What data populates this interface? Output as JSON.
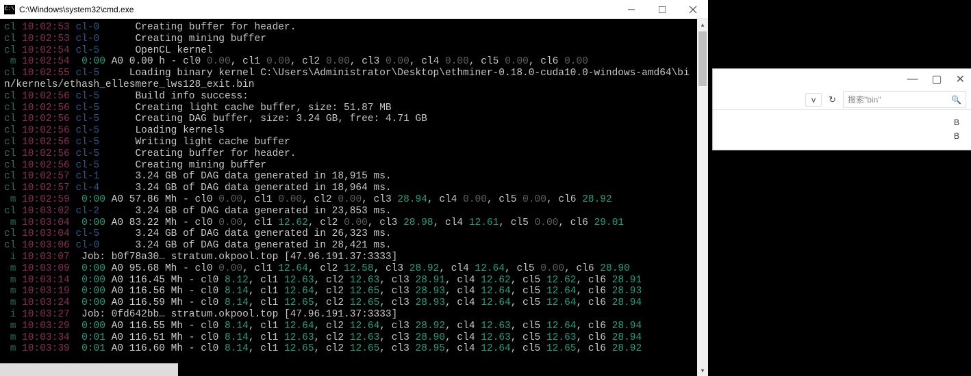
{
  "cmd": {
    "title": "C:\\Windows\\system32\\cmd.exe",
    "icon_label": "C:\\"
  },
  "bg": {
    "search_placeholder": "搜索\"bin\"",
    "row1": "B",
    "row2": "B"
  },
  "lines": [
    {
      "pid": "cl",
      "time": "10:02:53",
      "ctx": "cl-0",
      "type": "msg",
      "msg": "Creating buffer for header."
    },
    {
      "pid": "cl",
      "time": "10:02:53",
      "ctx": "cl-0",
      "type": "msg",
      "msg": "Creating mining buffer"
    },
    {
      "pid": "cl",
      "time": "10:02:54",
      "ctx": "cl-5",
      "type": "msg",
      "msg": "OpenCL kernel"
    },
    {
      "pid": " m",
      "time": "10:02:54",
      "ctx": "<unknown>",
      "type": "rate",
      "elapsed": "0:00",
      "a0": "0.00 h",
      "cls": [
        {
          "n": "cl0",
          "v": "0.00"
        },
        {
          "n": "cl1",
          "v": "0.00"
        },
        {
          "n": "cl2",
          "v": "0.00"
        },
        {
          "n": "cl3",
          "v": "0.00"
        },
        {
          "n": "cl4",
          "v": "0.00"
        },
        {
          "n": "cl5",
          "v": "0.00"
        },
        {
          "n": "cl6",
          "v": "0.00"
        }
      ]
    },
    {
      "pid": "cl",
      "time": "10:02:55",
      "ctx": "cl-5",
      "type": "longmsg",
      "msg": "Loading binary kernel C:\\Users\\Administrator\\Desktop\\ethminer-0.18.0-cuda10.0-windows-amd64\\bin/kernels/ethash_ellesmere_lws128_exit.bin"
    },
    {
      "pid": "cl",
      "time": "10:02:56",
      "ctx": "cl-5",
      "type": "msg",
      "msg": "Build info success:"
    },
    {
      "pid": "cl",
      "time": "10:02:56",
      "ctx": "cl-5",
      "type": "msg",
      "msg": "Creating light cache buffer, size: 51.87 MB"
    },
    {
      "pid": "cl",
      "time": "10:02:56",
      "ctx": "cl-5",
      "type": "msg",
      "msg": "Creating DAG buffer, size: 3.24 GB, free: 4.71 GB"
    },
    {
      "pid": "cl",
      "time": "10:02:56",
      "ctx": "cl-5",
      "type": "msg",
      "msg": "Loading kernels"
    },
    {
      "pid": "cl",
      "time": "10:02:56",
      "ctx": "cl-5",
      "type": "msg",
      "msg": "Writing light cache buffer"
    },
    {
      "pid": "cl",
      "time": "10:02:56",
      "ctx": "cl-5",
      "type": "msg",
      "msg": "Creating buffer for header."
    },
    {
      "pid": "cl",
      "time": "10:02:56",
      "ctx": "cl-5",
      "type": "msg",
      "msg": "Creating mining buffer"
    },
    {
      "pid": "cl",
      "time": "10:02:57",
      "ctx": "cl-1",
      "type": "msg",
      "msg": "3.24 GB of DAG data generated in 18,915 ms."
    },
    {
      "pid": "cl",
      "time": "10:02:57",
      "ctx": "cl-4",
      "type": "msg",
      "msg": "3.24 GB of DAG data generated in 18,964 ms."
    },
    {
      "pid": " m",
      "time": "10:02:59",
      "ctx": "<unknown>",
      "type": "rate",
      "elapsed": "0:00",
      "a0": "57.86 Mh",
      "cls": [
        {
          "n": "cl0",
          "v": "0.00"
        },
        {
          "n": "cl1",
          "v": "0.00"
        },
        {
          "n": "cl2",
          "v": "0.00"
        },
        {
          "n": "cl3",
          "v": "28.94"
        },
        {
          "n": "cl4",
          "v": "0.00"
        },
        {
          "n": "cl5",
          "v": "0.00"
        },
        {
          "n": "cl6",
          "v": "28.92"
        }
      ]
    },
    {
      "pid": "cl",
      "time": "10:03:02",
      "ctx": "cl-2",
      "type": "msg",
      "msg": "3.24 GB of DAG data generated in 23,853 ms."
    },
    {
      "pid": " m",
      "time": "10:03:04",
      "ctx": "<unknown>",
      "type": "rate",
      "elapsed": "0:00",
      "a0": "83.22 Mh",
      "cls": [
        {
          "n": "cl0",
          "v": "0.00"
        },
        {
          "n": "cl1",
          "v": "12.62"
        },
        {
          "n": "cl2",
          "v": "0.00"
        },
        {
          "n": "cl3",
          "v": "28.98"
        },
        {
          "n": "cl4",
          "v": "12.61"
        },
        {
          "n": "cl5",
          "v": "0.00"
        },
        {
          "n": "cl6",
          "v": "29.01"
        }
      ]
    },
    {
      "pid": "cl",
      "time": "10:03:04",
      "ctx": "cl-5",
      "type": "msg",
      "msg": "3.24 GB of DAG data generated in 26,323 ms."
    },
    {
      "pid": "cl",
      "time": "10:03:06",
      "ctx": "cl-0",
      "type": "msg",
      "msg": "3.24 GB of DAG data generated in 28,421 ms."
    },
    {
      "pid": " i",
      "time": "10:03:07",
      "ctx": "<unknown>",
      "type": "job",
      "msg": "Job: b0f78a30… stratum.okpool.top [47.96.191.37:3333]"
    },
    {
      "pid": " m",
      "time": "10:03:09",
      "ctx": "<unknown>",
      "type": "rate",
      "elapsed": "0:00",
      "a0": "95.68 Mh",
      "cls": [
        {
          "n": "cl0",
          "v": "0.00"
        },
        {
          "n": "cl1",
          "v": "12.64"
        },
        {
          "n": "cl2",
          "v": "12.58"
        },
        {
          "n": "cl3",
          "v": "28.92"
        },
        {
          "n": "cl4",
          "v": "12.64"
        },
        {
          "n": "cl5",
          "v": "0.00"
        },
        {
          "n": "cl6",
          "v": "28.90"
        }
      ]
    },
    {
      "pid": " m",
      "time": "10:03:14",
      "ctx": "<unknown>",
      "type": "rate",
      "elapsed": "0:00",
      "a0": "116.45 Mh",
      "cls": [
        {
          "n": "cl0",
          "v": "8.12"
        },
        {
          "n": "cl1",
          "v": "12.63"
        },
        {
          "n": "cl2",
          "v": "12.63"
        },
        {
          "n": "cl3",
          "v": "28.91"
        },
        {
          "n": "cl4",
          "v": "12.62"
        },
        {
          "n": "cl5",
          "v": "12.62"
        },
        {
          "n": "cl6",
          "v": "28.91"
        }
      ]
    },
    {
      "pid": " m",
      "time": "10:03:19",
      "ctx": "<unknown>",
      "type": "rate",
      "elapsed": "0:00",
      "a0": "116.56 Mh",
      "cls": [
        {
          "n": "cl0",
          "v": "8.14"
        },
        {
          "n": "cl1",
          "v": "12.64"
        },
        {
          "n": "cl2",
          "v": "12.65"
        },
        {
          "n": "cl3",
          "v": "28.93"
        },
        {
          "n": "cl4",
          "v": "12.64"
        },
        {
          "n": "cl5",
          "v": "12.64"
        },
        {
          "n": "cl6",
          "v": "28.93"
        }
      ]
    },
    {
      "pid": " m",
      "time": "10:03:24",
      "ctx": "<unknown>",
      "type": "rate",
      "elapsed": "0:00",
      "a0": "116.59 Mh",
      "cls": [
        {
          "n": "cl0",
          "v": "8.14"
        },
        {
          "n": "cl1",
          "v": "12.65"
        },
        {
          "n": "cl2",
          "v": "12.65"
        },
        {
          "n": "cl3",
          "v": "28.93"
        },
        {
          "n": "cl4",
          "v": "12.64"
        },
        {
          "n": "cl5",
          "v": "12.64"
        },
        {
          "n": "cl6",
          "v": "28.94"
        }
      ]
    },
    {
      "pid": " i",
      "time": "10:03:27",
      "ctx": "<unknown>",
      "type": "job",
      "msg": "Job: 0fd642bb… stratum.okpool.top [47.96.191.37:3333]"
    },
    {
      "pid": " m",
      "time": "10:03:29",
      "ctx": "<unknown>",
      "type": "rate",
      "elapsed": "0:00",
      "a0": "116.55 Mh",
      "cls": [
        {
          "n": "cl0",
          "v": "8.14"
        },
        {
          "n": "cl1",
          "v": "12.64"
        },
        {
          "n": "cl2",
          "v": "12.64"
        },
        {
          "n": "cl3",
          "v": "28.92"
        },
        {
          "n": "cl4",
          "v": "12.63"
        },
        {
          "n": "cl5",
          "v": "12.64"
        },
        {
          "n": "cl6",
          "v": "28.94"
        }
      ]
    },
    {
      "pid": " m",
      "time": "10:03:34",
      "ctx": "<unknown>",
      "type": "rate",
      "elapsed": "0:01",
      "a0": "116.51 Mh",
      "cls": [
        {
          "n": "cl0",
          "v": "8.14"
        },
        {
          "n": "cl1",
          "v": "12.63"
        },
        {
          "n": "cl2",
          "v": "12.63"
        },
        {
          "n": "cl3",
          "v": "28.90"
        },
        {
          "n": "cl4",
          "v": "12.63"
        },
        {
          "n": "cl5",
          "v": "12.63"
        },
        {
          "n": "cl6",
          "v": "28.94"
        }
      ]
    },
    {
      "pid": " m",
      "time": "10:03:39",
      "ctx": "<unknown>",
      "type": "rate",
      "elapsed": "0:01",
      "a0": "116.60 Mh",
      "cls": [
        {
          "n": "cl0",
          "v": "8.14"
        },
        {
          "n": "cl1",
          "v": "12.65"
        },
        {
          "n": "cl2",
          "v": "12.65"
        },
        {
          "n": "cl3",
          "v": "28.95"
        },
        {
          "n": "cl4",
          "v": "12.64"
        },
        {
          "n": "cl5",
          "v": "12.65"
        },
        {
          "n": "cl6",
          "v": "28.92"
        }
      ]
    }
  ]
}
